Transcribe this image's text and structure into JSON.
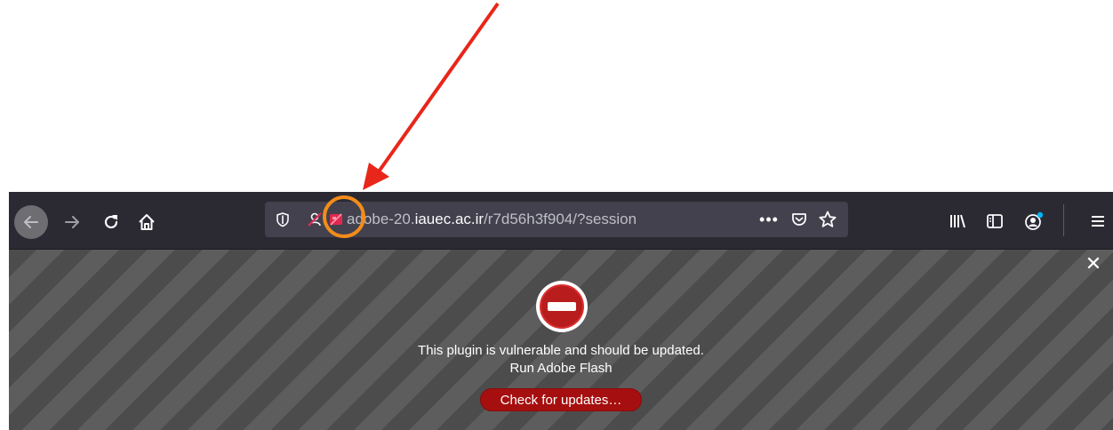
{
  "url": {
    "subdomain": "adobe-20.",
    "host": "iauec.ac.ir",
    "path": "/r7d56h3f904/?session"
  },
  "urlbar_actions": {
    "more_label": "•••"
  },
  "plugin_notice": {
    "message": "This plugin is vulnerable and should be updated.",
    "plugin_name": "Run Adobe Flash",
    "button_label": "Check for updates…",
    "close_label": "✕"
  },
  "colors": {
    "annotation_arrow": "#e8261a",
    "annotation_circle": "#f28c1a",
    "update_button": "#a60f0f",
    "toolbar": "#2b2a33",
    "urlbar": "#42414d"
  },
  "icons": {
    "back": "back-arrow-icon",
    "forward": "forward-arrow-icon",
    "reload": "reload-icon",
    "home": "home-icon",
    "tracking": "shield-icon",
    "permissions": "permissions-icon",
    "plugin": "plugin-blocked-icon",
    "pocket": "pocket-icon",
    "bookmark": "star-icon",
    "library": "library-icon",
    "sidebar": "sidebar-icon",
    "account": "account-icon",
    "menu": "hamburger-menu-icon",
    "block": "no-entry-icon"
  }
}
